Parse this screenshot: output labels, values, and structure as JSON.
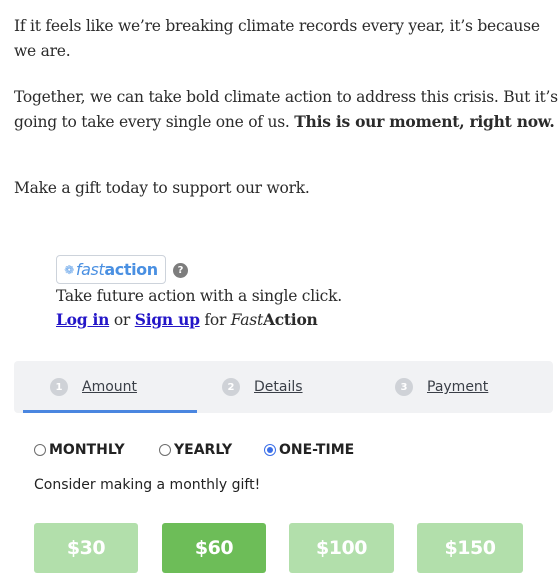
{
  "intro": {
    "p1": "If it feels like we’re breaking climate records every year, it’s because we are.",
    "p2_plain": "Together, we can take bold climate action to address this crisis. But it’s going to take every single one of us. ",
    "p2_bold": "This is our moment, right now.",
    "p3": "Make a gift today to support our work."
  },
  "fastaction": {
    "logo_fast": "fast",
    "logo_action": "action",
    "logo_icon": "gear-icon",
    "help_icon": "?",
    "tagline": "Take future action with a single click.",
    "login_label": "Log in",
    "or_text": " or ",
    "signup_label": "Sign up",
    "for_text": " for ",
    "brand_italic": "Fast",
    "brand_bold": "Action"
  },
  "steps": {
    "active_index": 0,
    "items": [
      {
        "number": "1",
        "label": "Amount"
      },
      {
        "number": "2",
        "label": "Details"
      },
      {
        "number": "3",
        "label": "Payment"
      }
    ]
  },
  "frequency": {
    "selected": "ONE-TIME",
    "options": [
      {
        "label": "MONTHLY",
        "checked": false
      },
      {
        "label": "YEARLY",
        "checked": false
      },
      {
        "label": "ONE-TIME",
        "checked": true
      }
    ],
    "hint": "Consider making a monthly gift!"
  },
  "amounts": {
    "selected": "$60",
    "options": [
      "$30",
      "$60",
      "$100",
      "$150"
    ],
    "colors": {
      "default": "#b2dfab",
      "selected": "#6dbd58"
    }
  },
  "colors": {
    "accent": "#4a86e0",
    "link": "#2416c8",
    "tab_bg": "#f1f2f4"
  }
}
